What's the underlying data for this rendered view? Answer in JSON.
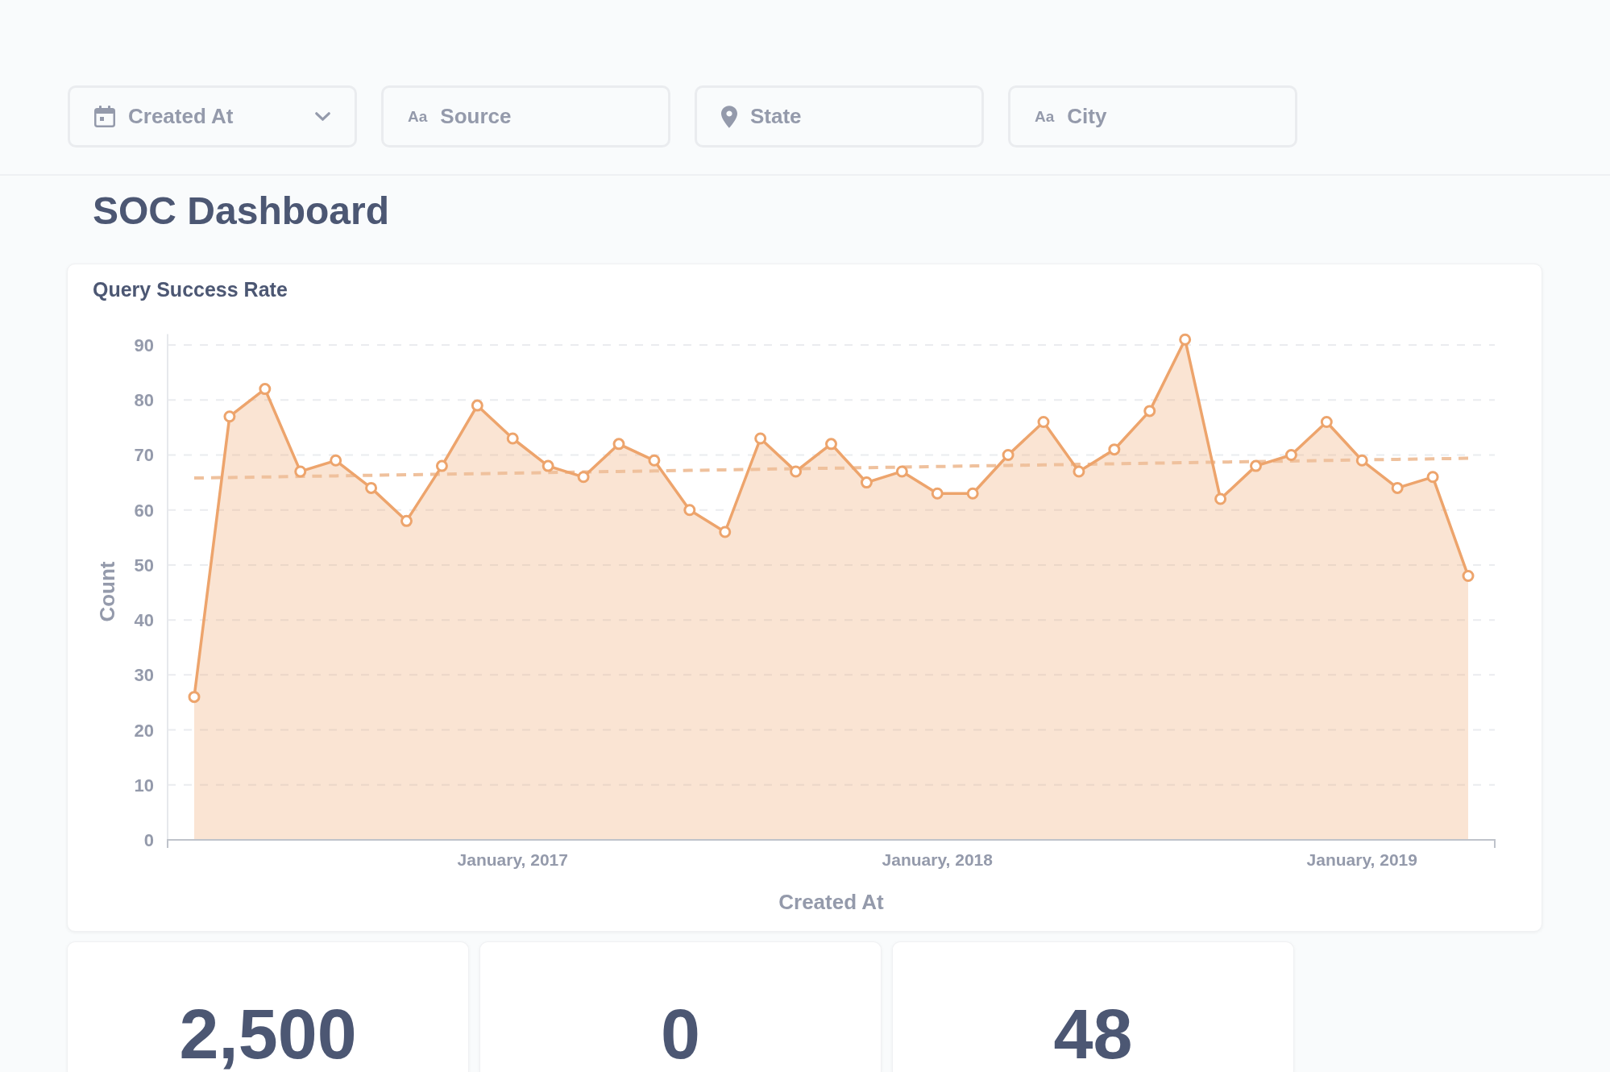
{
  "filters": [
    {
      "kind": "date",
      "label": "Created At",
      "dropdown": true
    },
    {
      "kind": "text",
      "icon_glyph": "Aa",
      "label": "Source",
      "dropdown": false
    },
    {
      "kind": "location",
      "label": "State",
      "dropdown": false
    },
    {
      "kind": "text",
      "icon_glyph": "Aa",
      "label": "City",
      "dropdown": false
    }
  ],
  "dashboard": {
    "title": "SOC Dashboard"
  },
  "chart_card": {
    "title": "Query Success Rate",
    "chart_data": {
      "type": "area",
      "xlabel": "Created At",
      "ylabel": "Count",
      "categories": [
        null,
        null,
        null,
        null,
        null,
        null,
        null,
        null,
        null,
        "January, 2017",
        null,
        null,
        null,
        null,
        null,
        null,
        null,
        null,
        null,
        null,
        null,
        "January, 2018",
        null,
        null,
        null,
        null,
        null,
        null,
        null,
        null,
        null,
        null,
        null,
        "January, 2019",
        null,
        null,
        null
      ],
      "series": [
        {
          "color": "#eda46c",
          "values": [
            26,
            77,
            82,
            67,
            69,
            64,
            58,
            68,
            79,
            73,
            68,
            66,
            72,
            69,
            60,
            56,
            73,
            67,
            72,
            65,
            67,
            63,
            63,
            70,
            76,
            67,
            71,
            78,
            91,
            62,
            68,
            70,
            76,
            69,
            64,
            66,
            48
          ]
        },
        {
          "type": "line",
          "line_style": "dashed",
          "color": "#efc19d",
          "values": [
            65.8,
            65.9,
            66.0,
            66.1,
            66.2,
            66.3,
            66.4,
            66.5,
            66.6,
            66.7,
            66.8,
            66.9,
            67.0,
            67.1,
            67.2,
            67.3,
            67.4,
            67.5,
            67.6,
            67.7,
            67.8,
            67.9,
            68.0,
            68.1,
            68.2,
            68.3,
            68.4,
            68.5,
            68.6,
            68.7,
            68.8,
            68.9,
            69.0,
            69.1,
            69.2,
            69.3,
            69.4
          ]
        }
      ],
      "ylim": [
        0,
        92
      ],
      "yticks": [
        0,
        10,
        20,
        30,
        40,
        50,
        60,
        70,
        80,
        90
      ],
      "grid": true
    }
  },
  "scalar_cards": [
    {
      "value": "2,500"
    },
    {
      "value": "0"
    },
    {
      "value": "48"
    }
  ]
}
